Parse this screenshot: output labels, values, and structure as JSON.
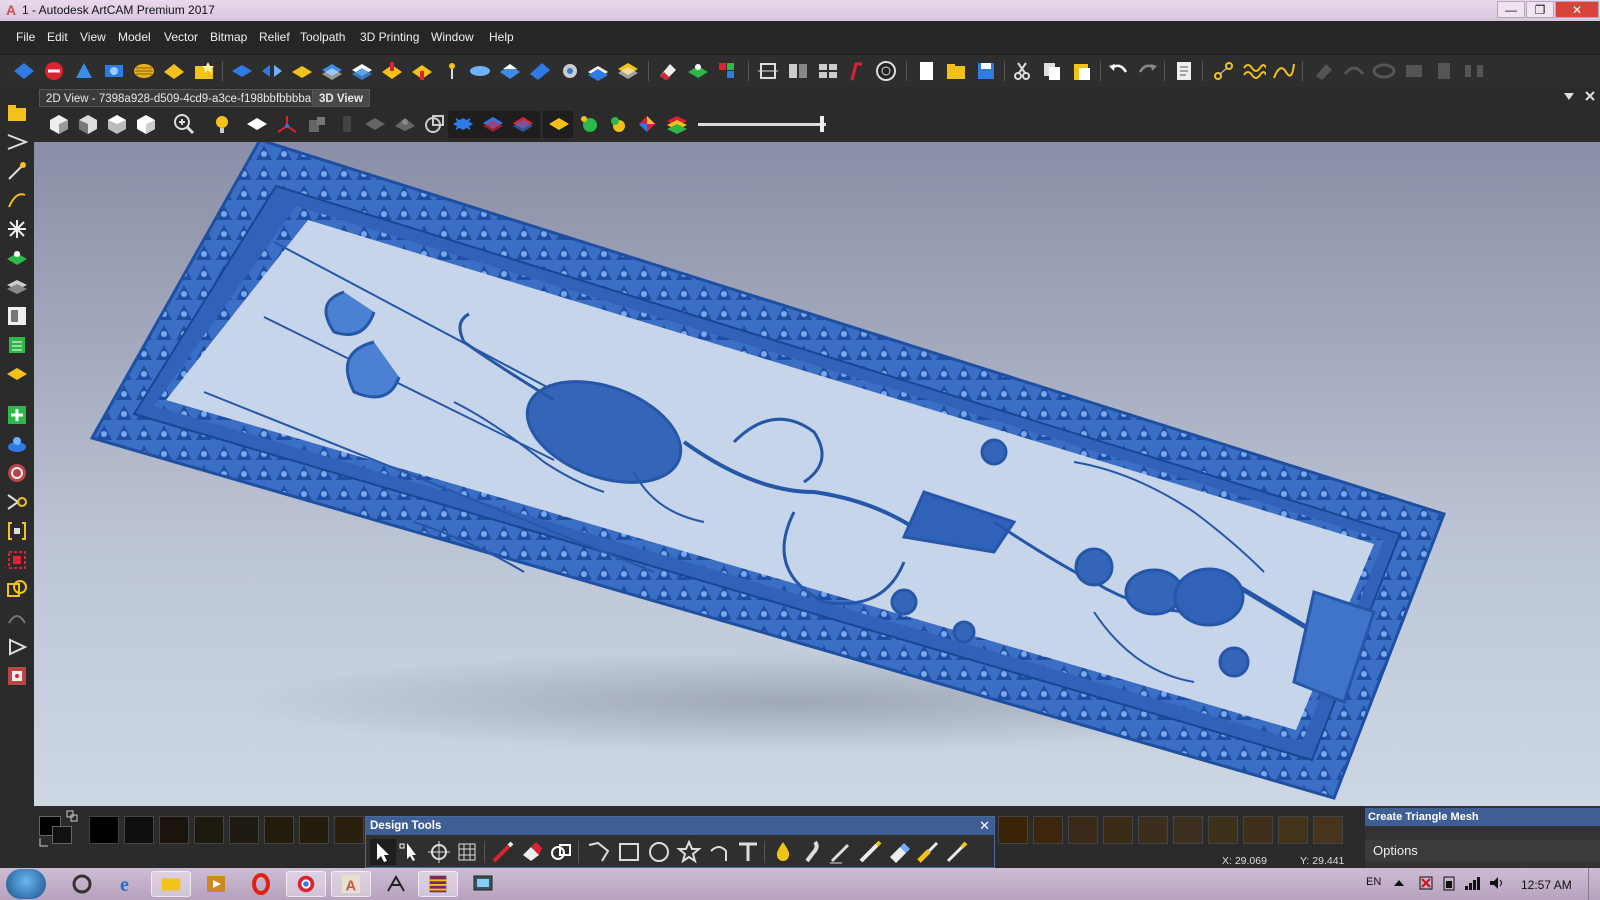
{
  "window": {
    "title": "1 - Autodesk ArtCAM Premium 2017",
    "app_letter": "A"
  },
  "menu": [
    "File",
    "Edit",
    "View",
    "Model",
    "Vector",
    "Bitmap",
    "Relief",
    "Toolpath",
    "3D Printing",
    "Window",
    "Help"
  ],
  "tabs": {
    "doc2d": "2D View - 7398a928-d509-4cd9-a3ce-f198bbfbbbba",
    "view3d": "3D View"
  },
  "design_tools": {
    "title": "Design Tools",
    "close": "✕"
  },
  "status": {
    "x": "X: 29.069",
    "y": "Y: 29.441"
  },
  "right_panel": {
    "title": "Create Triangle Mesh",
    "options": "Options"
  },
  "tray": {
    "lang": "EN",
    "time": "12:57 AM"
  },
  "colors": {
    "relief": "#3f74c8",
    "accent": "#3f5f94",
    "bg": "#2b2b2b"
  }
}
